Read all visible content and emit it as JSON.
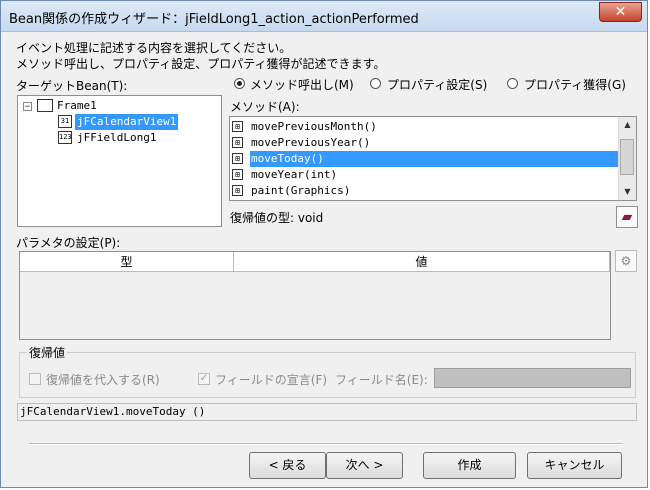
{
  "window": {
    "title": "Bean関係の作成ウィザード：jFieldLong1_action_actionPerformed",
    "close_symbol": "✕"
  },
  "instructions": {
    "line1": "イベント処理に記述する内容を選択してください。",
    "line2": "メソッド呼出し、プロパティ設定、プロパティ獲得が記述できます。"
  },
  "target_bean": {
    "label": "ターゲットBean(T):",
    "tree": [
      {
        "label": "Frame1",
        "expander": "−"
      },
      {
        "label": "jFCalendarView1",
        "icon_text": "31",
        "selected": true
      },
      {
        "label": "jFFieldLong1",
        "icon_text": "123"
      }
    ]
  },
  "mode": {
    "options": [
      {
        "label": "メソッド呼出し(M)",
        "checked": true
      },
      {
        "label": "プロパティ設定(S)",
        "checked": false
      },
      {
        "label": "プロパティ獲得(G)",
        "checked": false
      }
    ]
  },
  "methods": {
    "label": "メソッド(A):",
    "items": [
      {
        "label": "movePreviousMonth()"
      },
      {
        "label": "movePreviousYear()"
      },
      {
        "label": "moveToday()",
        "selected": true
      },
      {
        "label": "moveYear(int)"
      },
      {
        "label": "paint(Graphics)"
      }
    ],
    "return_type_label": "復帰値の型: void"
  },
  "parameters": {
    "label": "パラメタの設定(P):",
    "columns": [
      "型",
      "値"
    ]
  },
  "return_group": {
    "title": "復帰値",
    "assign_label": "復帰値を代入する(R)",
    "field_decl_label": "フィールドの宣言(F)",
    "field_name_label": "フィールド名(E):",
    "field_decl_checked": true
  },
  "status_text": "jFCalendarView1.moveToday ()",
  "buttons": {
    "back": "< 戻る",
    "next": "次へ >",
    "create": "作成",
    "cancel": "キャンセル"
  },
  "colors": {
    "selection": "#3399ff",
    "dialog_bg": "#f0f0f0",
    "close_red": "#c7432c"
  },
  "icons": {
    "book": "▰",
    "wand": "⚙",
    "method": "⊞",
    "check": "✓"
  }
}
